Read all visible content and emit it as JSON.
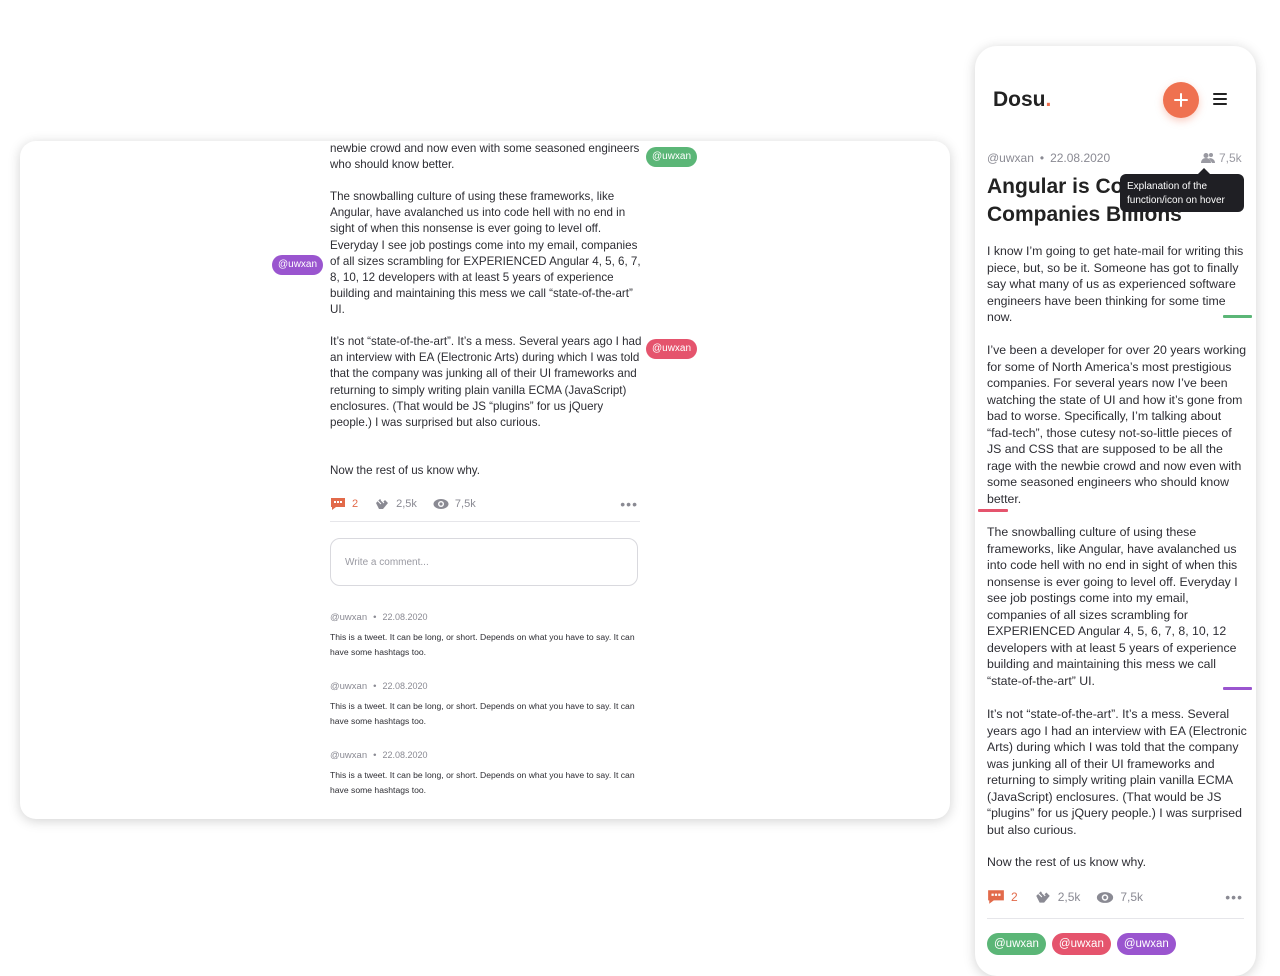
{
  "desktop": {
    "paragraphs": [
      "newbie crowd and now even with some seasoned engineers who should know better.",
      "The snowballing culture of using these frameworks, like Angular, have avalanched us into code hell with no end in sight of when this nonsense is ever going to level off. Everyday I see job postings come into my email, companies of all sizes scrambling for EXPERIENCED Angular 4, 5, 6, 7, 8, 10, 12 developers with at least 5 years of experience building and maintaining this mess we call “state-of-the-art” UI.",
      "It’s not “state-of-the-art”. It’s a mess. Several years ago I had an interview with EA (Electronic Arts) during which I was told that the company was junking all of their UI frameworks and returning to simply writing plain vanilla ECMA (JavaScript) enclosures. (That would be JS “plugins” for us jQuery people.) I was surprised but also curious.",
      "Now the rest of us know why."
    ],
    "tags": {
      "green": "@uwxan",
      "purple": "@uwxan",
      "red": "@uwxan"
    },
    "stats": {
      "comments": "2",
      "claps": "2,5k",
      "views": "7,5k",
      "more": "•••"
    },
    "comment_placeholder": "Write a comment...",
    "comments": [
      {
        "author": "@uwxan",
        "date": "22.08.2020",
        "text": "This is a tweet. It can be long, or short. Depends on what you have to say. It can have some hashtags too."
      },
      {
        "author": "@uwxan",
        "date": "22.08.2020",
        "text": "This is a tweet. It can be long, or short. Depends on what you have to say. It can have some hashtags too."
      },
      {
        "author": "@uwxan",
        "date": "22.08.2020",
        "text": "This is a tweet. It can be long, or short. Depends on what you have to say. It can have some hashtags too."
      }
    ]
  },
  "mobile": {
    "logo": "Dosu",
    "logo_dot": ".",
    "author": "@uwxan",
    "date": "22.08.2020",
    "views": "7,5k",
    "title": "Angular is Costing Companies Billions",
    "tooltip": "Explanation of the function/icon on hover",
    "paragraphs": [
      "I know I’m going to get hate-mail for writing this piece, but, so be it. Someone has got to finally say what many of us as experienced software engineers have been thinking for some time now.",
      "I’ve been a developer for over 20 years working for some of North America’s most prestigious companies. For several years now I’ve been watching the state of UI and how it’s gone from bad to worse. Specifically, I’m talking about “fad-tech”, those cutesy not-so-little pieces of JS and CSS that are supposed to be all the rage with the newbie crowd and now even with some seasoned engineers who should know better.",
      "The snowballing culture of using these frameworks, like Angular, have avalanched us into code hell with no end in sight of when this nonsense is ever going to level off. Everyday I see job postings come into my email, companies of all sizes scrambling for EXPERIENCED Angular 4, 5, 6, 7, 8, 10, 12 developers with at least 5 years of experience building and maintaining this mess we call “state-of-the-art” UI.",
      "It’s not “state-of-the-art”. It’s a mess. Several years ago I had an interview with EA (Electronic Arts) during which I was told that the company was junking all of their UI frameworks and returning to simply writing plain vanilla ECMA (JavaScript) enclosures. (That would be JS “plugins” for us jQuery people.) I was surprised but also curious.",
      "Now the rest of us know why."
    ],
    "stats": {
      "comments": "2",
      "claps": "2,5k",
      "views": "7,5k",
      "more": "•••"
    },
    "tags": [
      "@uwxan",
      "@uwxan",
      "@uwxan"
    ]
  },
  "colors": {
    "accent": "#ef7150",
    "green": "#5bb677",
    "red": "#e5546d",
    "purple": "#9a55cf"
  },
  "icons": {
    "comments": "comment-bubble-icon",
    "claps": "clap-icon",
    "views": "eye-icon",
    "add": "plus-icon",
    "menu": "hamburger-menu-icon",
    "readers": "users-icon"
  }
}
